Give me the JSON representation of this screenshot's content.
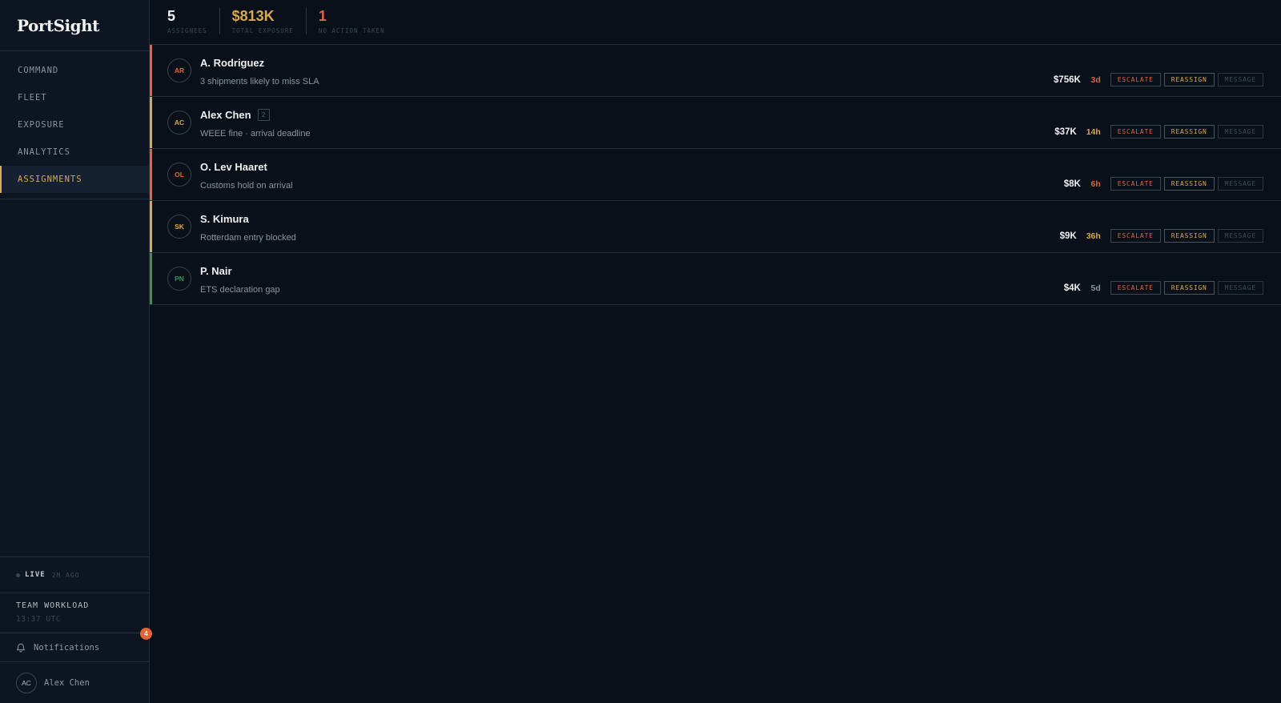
{
  "app": {
    "name": "PortSight"
  },
  "nav": [
    {
      "label": "COMMAND",
      "active": false
    },
    {
      "label": "FLEET",
      "active": false
    },
    {
      "label": "EXPOSURE",
      "active": false
    },
    {
      "label": "ANALYTICS",
      "active": false
    },
    {
      "label": "ASSIGNMENTS",
      "active": true
    }
  ],
  "status": {
    "live": "LIVE",
    "ago": "2M AGO"
  },
  "workload": {
    "title": "TEAM WORKLOAD",
    "time": "13:37 UTC"
  },
  "notifications": {
    "label": "Notifications",
    "count": "4"
  },
  "user": {
    "initials": "AC",
    "name": "Alex Chen"
  },
  "stats": [
    {
      "value": "5",
      "label": "ASSIGNEES",
      "color": "#eef0f2"
    },
    {
      "value": "$813K",
      "label": "TOTAL EXPOSURE",
      "color": "#d9a851"
    },
    {
      "value": "1",
      "label": "NO ACTION TAKEN",
      "color": "#e2653a"
    }
  ],
  "actions": {
    "escalate": "ESCALATE",
    "reassign": "REASSIGN",
    "message": "MESSAGE"
  },
  "colors": {
    "red": "#e2653a",
    "amber": "#d9a851",
    "green": "#3f8f5a"
  },
  "assignees": [
    {
      "initials": "AR",
      "name": "A. Rodriguez",
      "count": "",
      "desc": "3 shipments likely to miss SLA",
      "amount": "$756K",
      "due": "3d",
      "severity": "red",
      "dueColor": "#d9653d"
    },
    {
      "initials": "AC",
      "name": "Alex Chen",
      "count": "2",
      "desc": "WEEE fine · arrival deadline",
      "amount": "$37K",
      "due": "14h",
      "severity": "amber",
      "dueColor": "#d9a851"
    },
    {
      "initials": "OL",
      "name": "O. Lev Haaret",
      "count": "",
      "desc": "Customs hold on arrival",
      "amount": "$8K",
      "due": "6h",
      "severity": "red",
      "dueColor": "#d9653d"
    },
    {
      "initials": "SK",
      "name": "S. Kimura",
      "count": "",
      "desc": "Rotterdam entry blocked",
      "amount": "$9K",
      "due": "36h",
      "severity": "amber",
      "dueColor": "#d9a851"
    },
    {
      "initials": "PN",
      "name": "P. Nair",
      "count": "",
      "desc": "ETS declaration gap",
      "amount": "$4K",
      "due": "5d",
      "severity": "green",
      "dueColor": "#8a94a2"
    }
  ]
}
